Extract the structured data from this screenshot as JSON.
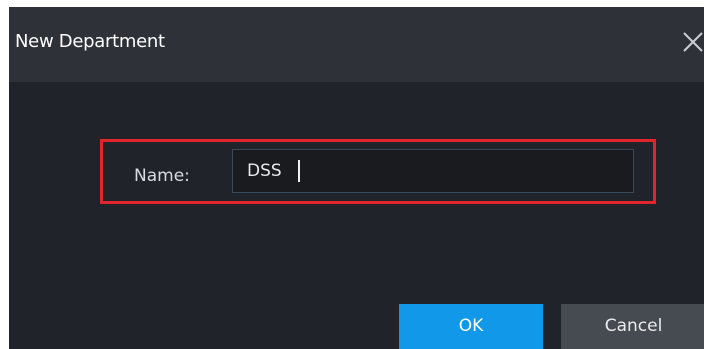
{
  "dialog": {
    "title": "New Department",
    "close_icon": "close-icon"
  },
  "form": {
    "name_label": "Name:",
    "name_value": "DSS"
  },
  "buttons": {
    "ok_label": "OK",
    "cancel_label": "Cancel"
  },
  "colors": {
    "titlebar_bg": "#2e3138",
    "dialog_bg": "#202329",
    "highlight_border": "#e0262b",
    "ok_bg": "#1198e9",
    "cancel_bg": "#464b52"
  }
}
